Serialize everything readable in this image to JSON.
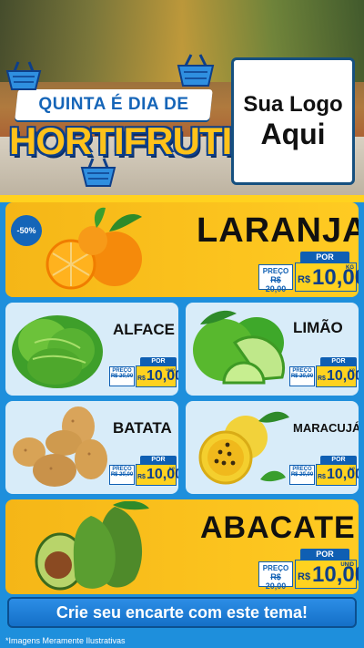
{
  "header": {
    "title_top": "QUINTA É DIA DE",
    "title_main": "HORTIFRUTI",
    "logo_line1": "Sua Logo",
    "logo_line2": "Aqui"
  },
  "products": [
    {
      "name": "LARANJA",
      "discount": "-50%",
      "por": "POR",
      "preco_label": "PREÇO",
      "old_price": "R$ 20,00",
      "currency": "R$",
      "price": "10,00",
      "unit": "KG"
    },
    {
      "name": "ALFACE",
      "por": "POR",
      "preco_label": "PREÇO",
      "old_price": "R$ 20,00",
      "currency": "R$",
      "price": "10,00",
      "unit": "UNID"
    },
    {
      "name": "LIMÃO",
      "por": "POR",
      "preco_label": "PREÇO",
      "old_price": "R$ 20,00",
      "currency": "R$",
      "price": "10,00",
      "unit": "KG"
    },
    {
      "name": "BATATA",
      "por": "POR",
      "preco_label": "PREÇO",
      "old_price": "R$ 20,00",
      "currency": "R$",
      "price": "10,00",
      "unit": "KG"
    },
    {
      "name": "MARACUJÁ",
      "por": "POR",
      "preco_label": "PREÇO",
      "old_price": "R$ 20,00",
      "currency": "R$",
      "price": "10,00",
      "unit": "KG"
    },
    {
      "name": "ABACATE",
      "por": "POR",
      "preco_label": "PREÇO",
      "old_price": "R$ 20,00",
      "currency": "R$",
      "price": "10,00",
      "unit": "UNID"
    }
  ],
  "footer": {
    "cta": "Crie seu encarte com este tema!",
    "disclaimer": "*Imagens Meramente Ilustrativas"
  },
  "colors": {
    "brand_blue": "#1565b8",
    "accent_yellow": "#ffd21f",
    "title_yellow": "#ffc21a",
    "background_blue": "#1e8fdc"
  },
  "icons": [
    "basket-icon",
    "orange-icon",
    "lettuce-icon",
    "lime-icon",
    "potato-icon",
    "passion-fruit-icon",
    "avocado-icon"
  ]
}
